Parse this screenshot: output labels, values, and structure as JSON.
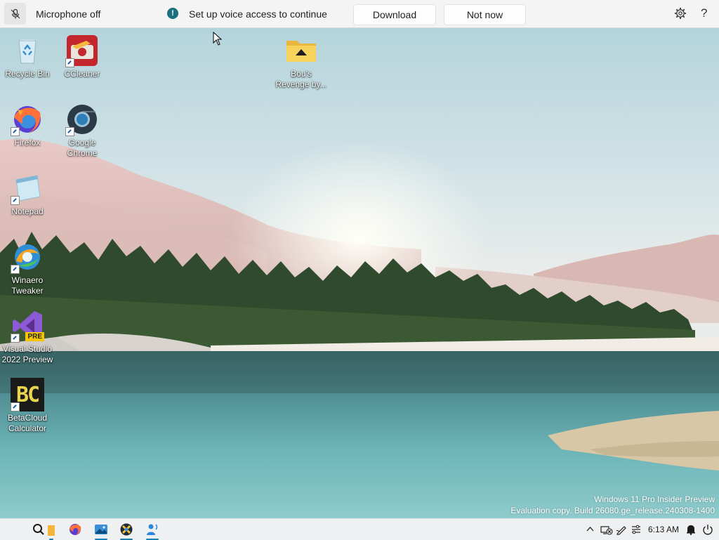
{
  "voice_bar": {
    "mic_status": "Microphone off",
    "message": "Set up voice access to continue",
    "download_label": "Download",
    "not_now_label": "Not now",
    "help_label": "?"
  },
  "desktop_icons": [
    {
      "label": "Recycle Bin",
      "icon": "recycle-bin-icon"
    },
    {
      "label": "CCleaner",
      "icon": "ccleaner-icon"
    },
    {
      "label": "Bou's Revenge by...",
      "icon": "folder-icon"
    },
    {
      "label": "Firefox",
      "icon": "firefox-icon"
    },
    {
      "label": "Google Chrome",
      "icon": "chrome-icon"
    },
    {
      "label": "Notepad",
      "icon": "notepad-icon"
    },
    {
      "label": "Winaero Tweaker",
      "icon": "winaero-tweaker-icon"
    },
    {
      "label": "Visual Studio 2022 Preview",
      "icon": "visual-studio-preview-icon"
    },
    {
      "label": "BetaCloud Calculator",
      "icon": "betacloud-calculator-icon"
    }
  ],
  "vs_badge": "PRE",
  "bc_letters": "BC",
  "watermark": {
    "line1": "Windows 11 Pro Insider Preview",
    "line2": "Evaluation copy. Build 26080.ge_release.240308-1400"
  },
  "taskbar": {
    "items": [
      "search-icon",
      "file-explorer-icon",
      "firefox-icon",
      "photos-icon",
      "winaero-tweaker-icon",
      "voice-access-icon"
    ],
    "clock": "6:13 AM",
    "tray_icons": [
      "chevron-up-icon",
      "network-disconnected-icon",
      "pen-icon",
      "voice-settings-icon",
      "notification-bell-icon",
      "power-icon"
    ]
  },
  "colors": {
    "accent": "#1d6f7f",
    "taskbar_indicator": "#1a7fb3"
  }
}
